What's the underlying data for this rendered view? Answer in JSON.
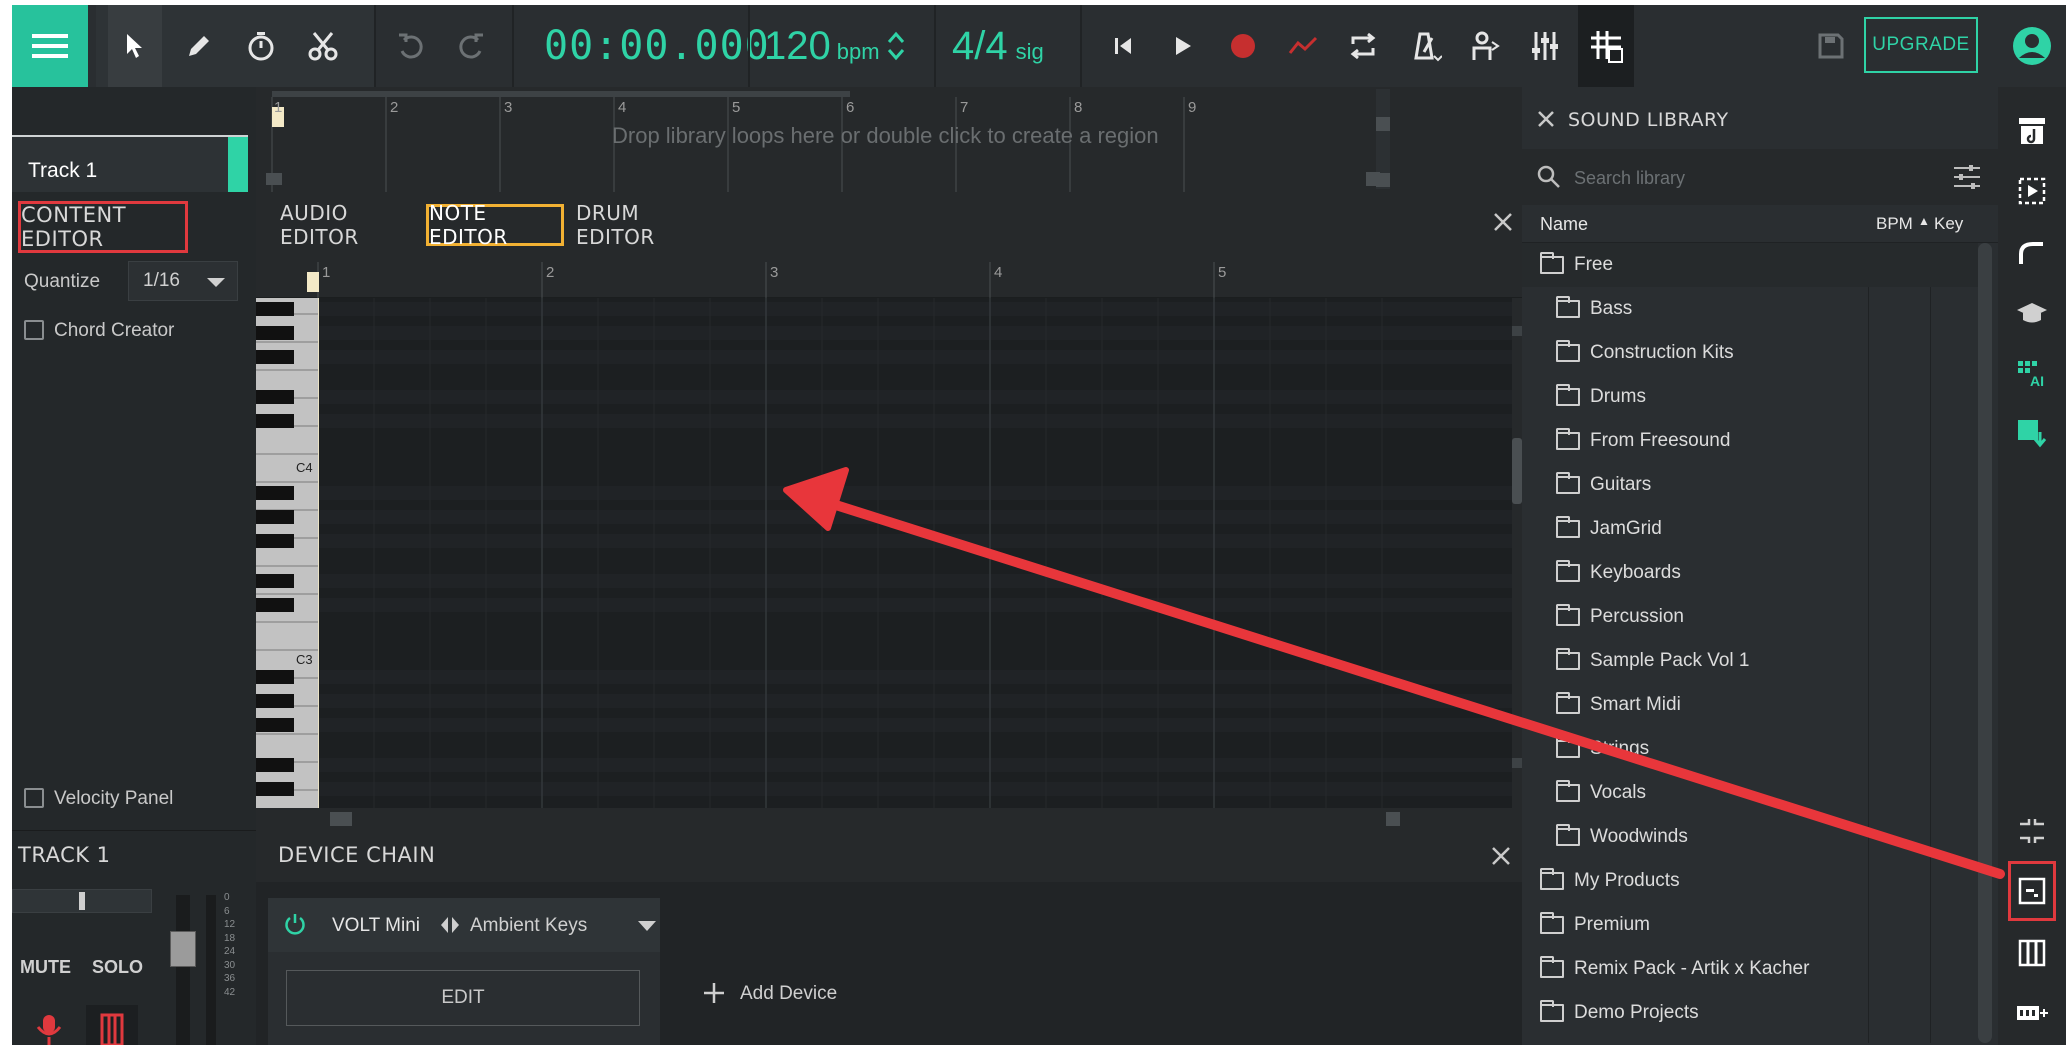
{
  "toolbar": {
    "timer": "00:00.000",
    "bpm_value": "120",
    "bpm_unit": "bpm",
    "sig_value": "4/4",
    "sig_unit": "sig",
    "upgrade_label": "UPGRADE"
  },
  "timeline": {
    "track_name": "Track 1",
    "ruler": [
      "1",
      "2",
      "3",
      "4",
      "5",
      "6",
      "7",
      "8",
      "9"
    ],
    "drop_hint": "Drop library loops here or double click to create a region"
  },
  "content_editor": {
    "title": "CONTENT EDITOR",
    "tabs": [
      {
        "label": "AUDIO EDITOR",
        "active": false
      },
      {
        "label": "NOTE EDITOR",
        "active": true
      },
      {
        "label": "DRUM EDITOR",
        "active": false
      }
    ],
    "quantize_label": "Quantize",
    "quantize_value": "1/16",
    "chord_creator_label": "Chord Creator",
    "velocity_panel_label": "Velocity Panel",
    "roll_ruler": [
      "1",
      "2",
      "3",
      "4",
      "5"
    ],
    "key_labels": [
      "C4",
      "C3"
    ]
  },
  "track_panel": {
    "title": "TRACK 1",
    "mute_label": "MUTE",
    "solo_label": "SOLO",
    "meter_ticks": [
      "0",
      "6",
      "12",
      "18",
      "24",
      "30",
      "36",
      "42"
    ]
  },
  "device_chain": {
    "title": "DEVICE CHAIN",
    "device_name": "VOLT Mini",
    "preset_name": "Ambient Keys",
    "edit_label": "EDIT",
    "add_device_label": "Add Device"
  },
  "library": {
    "title": "SOUND LIBRARY",
    "search_placeholder": "Search library",
    "col_name": "Name",
    "col_bpm": "BPM",
    "col_key": "Key",
    "items": [
      {
        "label": "Free",
        "level": 0
      },
      {
        "label": "Bass",
        "level": 1
      },
      {
        "label": "Construction Kits",
        "level": 1
      },
      {
        "label": "Drums",
        "level": 1
      },
      {
        "label": "From Freesound",
        "level": 1
      },
      {
        "label": "Guitars",
        "level": 1
      },
      {
        "label": "JamGrid",
        "level": 1
      },
      {
        "label": "Keyboards",
        "level": 1
      },
      {
        "label": "Percussion",
        "level": 1
      },
      {
        "label": "Sample Pack Vol 1",
        "level": 1
      },
      {
        "label": "Smart Midi",
        "level": 1
      },
      {
        "label": "Strings",
        "level": 1
      },
      {
        "label": "Vocals",
        "level": 1
      },
      {
        "label": "Woodwinds",
        "level": 1
      },
      {
        "label": "My Products",
        "level": 0
      },
      {
        "label": "Premium",
        "level": 0
      },
      {
        "label": "Remix Pack - Artik x Kacher",
        "level": 0
      },
      {
        "label": "Demo Projects",
        "level": 0
      }
    ]
  },
  "colors": {
    "accent": "#2fd3a6",
    "highlight_red": "#e0393e",
    "highlight_orange": "#f2b133",
    "record_red": "#c62f2f"
  }
}
